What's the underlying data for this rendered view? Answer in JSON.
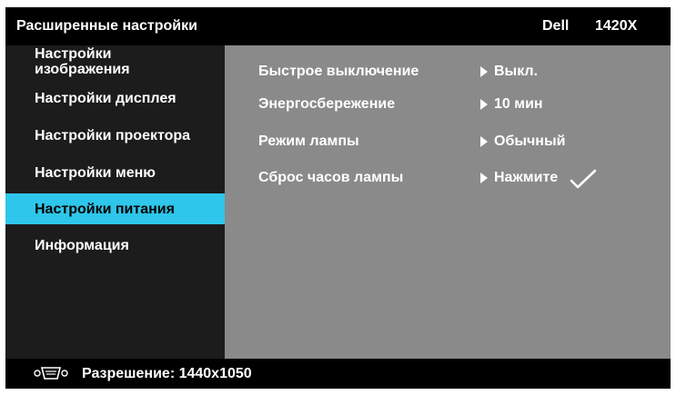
{
  "header": {
    "title": "Расширенные настройки",
    "brand": "Dell",
    "model": "1420X"
  },
  "sidebar": {
    "items": [
      {
        "label": "Настройки\nизображения",
        "active": false
      },
      {
        "label": "Настройки дисплея",
        "active": false
      },
      {
        "label": "Настройки проектора",
        "active": false
      },
      {
        "label": "Настройки меню",
        "active": false
      },
      {
        "label": "Настройки питания",
        "active": true
      },
      {
        "label": "Информация",
        "active": false
      }
    ]
  },
  "settings": [
    {
      "label": "Быстрое выключение",
      "value": "Выкл."
    },
    {
      "label": "Энергосбережение",
      "value": "10 мин"
    },
    {
      "label": "Режим лампы",
      "value": "Обычный"
    },
    {
      "label": "Сброс часов лампы",
      "value": "Нажмите",
      "icon": "checkmark-icon"
    }
  ],
  "footer": {
    "resolution": "Разрешение: 1440x1050",
    "icon": "vga-port-icon"
  },
  "colors": {
    "active_item_bg": "#2ec6ea",
    "sidebar_bg": "#1c1c1c",
    "content_bg": "#8a8a8a",
    "bar_bg": "#000000"
  }
}
